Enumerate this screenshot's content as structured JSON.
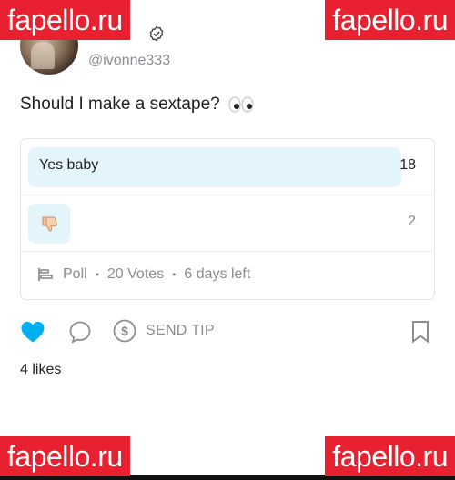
{
  "watermark": "fapello.ru",
  "post": {
    "handle": "@ivonne333",
    "text": "Should I make a sextape?",
    "text_emoji": "eyes"
  },
  "poll": {
    "options": [
      {
        "label": "Yes baby",
        "votes": 18
      },
      {
        "label": "",
        "emoji": "thumbs-down",
        "votes": 2
      }
    ],
    "footer": {
      "poll_label": "Poll",
      "votes_label": "20 Votes",
      "time_left": "6 days left"
    }
  },
  "actions": {
    "tip_label": "SEND TIP",
    "liked": true
  },
  "likes": {
    "count": "4",
    "label": "likes"
  },
  "colors": {
    "watermark_bg": "#e8202f",
    "accent": "#00aff0",
    "poll_bar": "#e4f4fb",
    "muted": "#8a8d91"
  }
}
